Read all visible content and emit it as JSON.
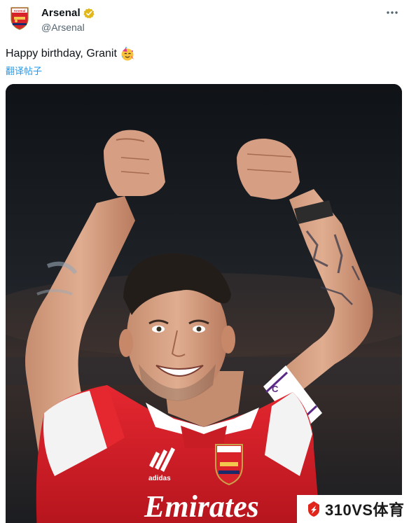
{
  "post": {
    "display_name": "Arsenal",
    "handle": "@Arsenal",
    "text": "Happy birthday, Granit",
    "translate_label": "翻译帖子"
  },
  "logo": {
    "crest_text": "Arsenal"
  },
  "icons": {
    "verified": "verified-badge-icon",
    "more": "more-options-icon",
    "emoji": "party-face-emoji"
  },
  "photo": {
    "shirt_text": "Emirates",
    "armband_text": "C",
    "sleeve_text": "adidas"
  },
  "watermark": {
    "text": "310VS体育"
  },
  "colors": {
    "arsenal_red": "#d8232a",
    "verified_gold": "#e2b719",
    "link_blue": "#1d9bf0",
    "text_primary": "#0f1419",
    "text_secondary": "#536471",
    "watermark_red": "#e0251b"
  }
}
